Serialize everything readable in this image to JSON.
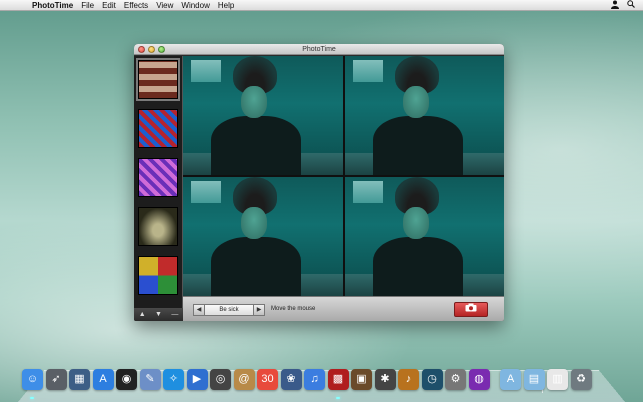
{
  "menubar": {
    "app_name": "PhotoTime",
    "items": [
      "File",
      "Edit",
      "Effects",
      "View",
      "Window",
      "Help"
    ]
  },
  "window": {
    "title": "PhotoTime"
  },
  "sidebar": {
    "effects": [
      {
        "name": "photo-booth-tiles",
        "colors": [
          "#6b2a1f",
          "#c7a58f"
        ]
      },
      {
        "name": "rainbow-pattern",
        "colors": [
          "#b5232f",
          "#1c5fcf"
        ]
      },
      {
        "name": "purple-kaleidoscope",
        "colors": [
          "#6a2fb8",
          "#d06bd8"
        ]
      },
      {
        "name": "vignette",
        "colors": [
          "#2a2a1a",
          "#b9b48a"
        ]
      },
      {
        "name": "color-quad",
        "colors": [
          "#c12b2b",
          "#2d8f38"
        ]
      }
    ],
    "footer": {
      "up": "▲",
      "down": "▼",
      "remove": "—"
    }
  },
  "controls": {
    "prev": "◀",
    "effect_name": "Be sick",
    "next": "▶",
    "hint": "Move the mouse",
    "camera_icon": "camera-icon"
  },
  "dock": {
    "apps": [
      {
        "name": "finder",
        "glyph": "☺",
        "color": "#3e8ee8"
      },
      {
        "name": "launchpad",
        "glyph": "➶",
        "color": "#5a5f66"
      },
      {
        "name": "mission-control",
        "glyph": "▦",
        "color": "#3d5e86"
      },
      {
        "name": "app-store",
        "glyph": "A",
        "color": "#2d7ee0"
      },
      {
        "name": "dashboard",
        "glyph": "◉",
        "color": "#222"
      },
      {
        "name": "preview",
        "glyph": "✎",
        "color": "#6d8fc7"
      },
      {
        "name": "safari",
        "glyph": "✧",
        "color": "#1f8fe0"
      },
      {
        "name": "facetime",
        "glyph": "▶",
        "color": "#2f6fd0"
      },
      {
        "name": "photo-booth",
        "glyph": "◎",
        "color": "#444"
      },
      {
        "name": "address-book",
        "glyph": "@",
        "color": "#b88a48"
      },
      {
        "name": "ical",
        "glyph": "30",
        "color": "#e84a3c"
      },
      {
        "name": "iphoto",
        "glyph": "❀",
        "color": "#3a5a8a"
      },
      {
        "name": "itunes",
        "glyph": "♫",
        "color": "#3b7de0"
      },
      {
        "name": "photo-time",
        "glyph": "▩",
        "color": "#b01e1e"
      },
      {
        "name": "image-capture",
        "glyph": "▣",
        "color": "#6a4a2a"
      },
      {
        "name": "bomb-app",
        "glyph": "✱",
        "color": "#444"
      },
      {
        "name": "garageband",
        "glyph": "♪",
        "color": "#b8721e"
      },
      {
        "name": "time-machine",
        "glyph": "◷",
        "color": "#1e4f6a"
      },
      {
        "name": "system-preferences",
        "glyph": "⚙",
        "color": "#777"
      },
      {
        "name": "color-sync",
        "glyph": "◍",
        "color": "#7a2bb0"
      },
      {
        "name": "applications-folder",
        "glyph": "A",
        "color": "#7fb6e0"
      },
      {
        "name": "documents-folder",
        "glyph": "▤",
        "color": "#7fb6e0"
      },
      {
        "name": "document-stack",
        "glyph": "▥",
        "color": "#e8e8e8"
      },
      {
        "name": "trash",
        "glyph": "♻",
        "color": "#6f7a80"
      }
    ]
  }
}
